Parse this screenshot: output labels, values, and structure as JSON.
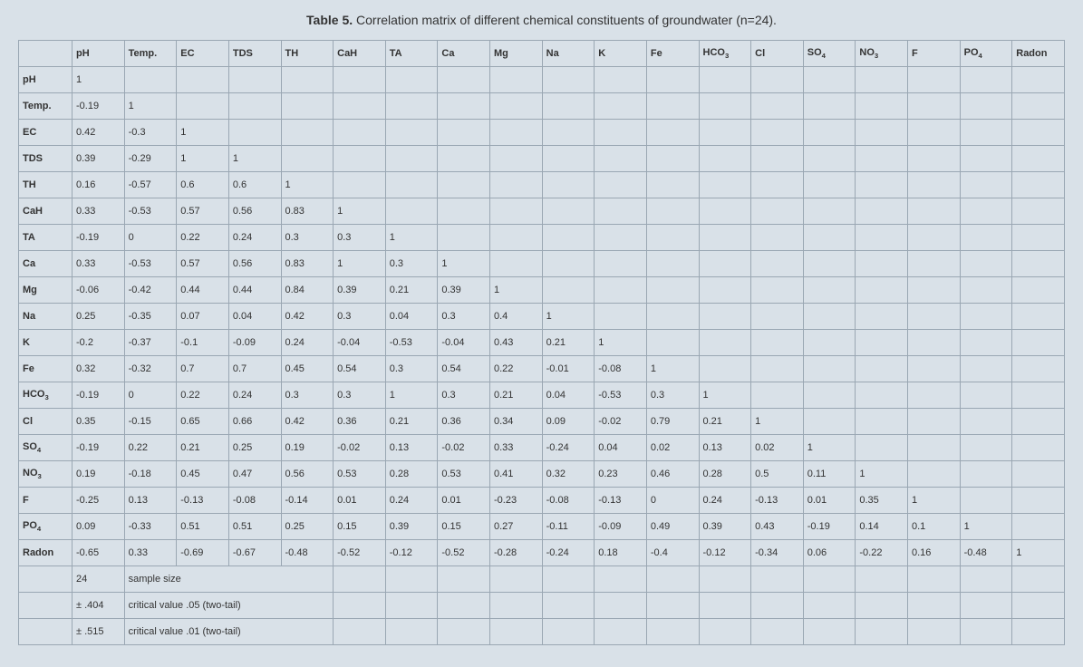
{
  "title_prefix": "Table 5.",
  "title_rest": " Correlation matrix of different chemical constituents of groundwater (n=24).",
  "headers": [
    "pH",
    "Temp.",
    "EC",
    "TDS",
    "TH",
    "CaH",
    "TA",
    "Ca",
    "Mg",
    "Na",
    "K",
    "Fe",
    "HCO3",
    "Cl",
    "SO4",
    "NO3",
    "F",
    "PO4",
    "Radon"
  ],
  "rows": [
    {
      "name": "pH",
      "vals": [
        "1"
      ]
    },
    {
      "name": "Temp.",
      "vals": [
        "-0.19",
        "1"
      ]
    },
    {
      "name": "EC",
      "vals": [
        "0.42",
        "-0.3",
        "1"
      ]
    },
    {
      "name": "TDS",
      "vals": [
        "0.39",
        "-0.29",
        "1",
        "1"
      ]
    },
    {
      "name": "TH",
      "vals": [
        "0.16",
        "-0.57",
        "0.6",
        "0.6",
        "1"
      ]
    },
    {
      "name": "CaH",
      "vals": [
        "0.33",
        "-0.53",
        "0.57",
        "0.56",
        "0.83",
        "1"
      ]
    },
    {
      "name": "TA",
      "vals": [
        "-0.19",
        "0",
        "0.22",
        "0.24",
        "0.3",
        "0.3",
        "1"
      ]
    },
    {
      "name": "Ca",
      "vals": [
        "0.33",
        "-0.53",
        "0.57",
        "0.56",
        "0.83",
        "1",
        "0.3",
        "1"
      ]
    },
    {
      "name": "Mg",
      "vals": [
        "-0.06",
        "-0.42",
        "0.44",
        "0.44",
        "0.84",
        "0.39",
        "0.21",
        "0.39",
        "1"
      ]
    },
    {
      "name": "Na",
      "vals": [
        "0.25",
        "-0.35",
        "0.07",
        "0.04",
        "0.42",
        "0.3",
        "0.04",
        "0.3",
        "0.4",
        "1"
      ]
    },
    {
      "name": "K",
      "vals": [
        "-0.2",
        "-0.37",
        "-0.1",
        "-0.09",
        "0.24",
        "-0.04",
        "-0.53",
        "-0.04",
        "0.43",
        "0.21",
        "1"
      ]
    },
    {
      "name": "Fe",
      "vals": [
        "0.32",
        "-0.32",
        "0.7",
        "0.7",
        "0.45",
        "0.54",
        "0.3",
        "0.54",
        "0.22",
        "-0.01",
        "-0.08",
        "1"
      ]
    },
    {
      "name": "HCO3",
      "vals": [
        "-0.19",
        "0",
        "0.22",
        "0.24",
        "0.3",
        "0.3",
        "1",
        "0.3",
        "0.21",
        "0.04",
        "-0.53",
        "0.3",
        "1"
      ]
    },
    {
      "name": "Cl",
      "vals": [
        "0.35",
        "-0.15",
        "0.65",
        "0.66",
        "0.42",
        "0.36",
        "0.21",
        "0.36",
        "0.34",
        "0.09",
        "-0.02",
        "0.79",
        "0.21",
        "1"
      ]
    },
    {
      "name": "SO4",
      "vals": [
        "-0.19",
        "0.22",
        "0.21",
        "0.25",
        "0.19",
        "-0.02",
        "0.13",
        "-0.02",
        "0.33",
        "-0.24",
        "0.04",
        "0.02",
        "0.13",
        "0.02",
        "1"
      ]
    },
    {
      "name": "NO3",
      "vals": [
        "0.19",
        "-0.18",
        "0.45",
        "0.47",
        "0.56",
        "0.53",
        "0.28",
        "0.53",
        "0.41",
        "0.32",
        "0.23",
        "0.46",
        "0.28",
        "0.5",
        "0.11",
        "1"
      ]
    },
    {
      "name": "F",
      "vals": [
        "-0.25",
        "0.13",
        "-0.13",
        "-0.08",
        "-0.14",
        "0.01",
        "0.24",
        "0.01",
        "-0.23",
        "-0.08",
        "-0.13",
        "0",
        "0.24",
        "-0.13",
        "0.01",
        "0.35",
        "1"
      ]
    },
    {
      "name": "PO4",
      "vals": [
        "0.09",
        "-0.33",
        "0.51",
        "0.51",
        "0.25",
        "0.15",
        "0.39",
        "0.15",
        "0.27",
        "-0.11",
        "-0.09",
        "0.49",
        "0.39",
        "0.43",
        "-0.19",
        "0.14",
        "0.1",
        "1"
      ]
    },
    {
      "name": "Radon",
      "vals": [
        "-0.65",
        "0.33",
        "-0.69",
        "-0.67",
        "-0.48",
        "-0.52",
        "-0.12",
        "-0.52",
        "-0.28",
        "-0.24",
        "0.18",
        "-0.4",
        "-0.12",
        "-0.34",
        "0.06",
        "-0.22",
        "0.16",
        "-0.48",
        "1"
      ]
    }
  ],
  "footer": [
    {
      "col1": "24",
      "span": "sample size"
    },
    {
      "col1": "± .404",
      "span": "critical value .05 (two-tail)"
    },
    {
      "col1": "± .515",
      "span": "critical value .01 (two-tail)"
    }
  ],
  "chart_data": {
    "type": "table",
    "title": "Correlation matrix of different chemical constituents of groundwater (n=24)",
    "variables": [
      "pH",
      "Temp.",
      "EC",
      "TDS",
      "TH",
      "CaH",
      "TA",
      "Ca",
      "Mg",
      "Na",
      "K",
      "Fe",
      "HCO3",
      "Cl",
      "SO4",
      "NO3",
      "F",
      "PO4",
      "Radon"
    ],
    "matrix": [
      [
        1
      ],
      [
        -0.19,
        1
      ],
      [
        0.42,
        -0.3,
        1
      ],
      [
        0.39,
        -0.29,
        1,
        1
      ],
      [
        0.16,
        -0.57,
        0.6,
        0.6,
        1
      ],
      [
        0.33,
        -0.53,
        0.57,
        0.56,
        0.83,
        1
      ],
      [
        -0.19,
        0,
        0.22,
        0.24,
        0.3,
        0.3,
        1
      ],
      [
        0.33,
        -0.53,
        0.57,
        0.56,
        0.83,
        1,
        0.3,
        1
      ],
      [
        -0.06,
        -0.42,
        0.44,
        0.44,
        0.84,
        0.39,
        0.21,
        0.39,
        1
      ],
      [
        0.25,
        -0.35,
        0.07,
        0.04,
        0.42,
        0.3,
        0.04,
        0.3,
        0.4,
        1
      ],
      [
        -0.2,
        -0.37,
        -0.1,
        -0.09,
        0.24,
        -0.04,
        -0.53,
        -0.04,
        0.43,
        0.21,
        1
      ],
      [
        0.32,
        -0.32,
        0.7,
        0.7,
        0.45,
        0.54,
        0.3,
        0.54,
        0.22,
        -0.01,
        -0.08,
        1
      ],
      [
        -0.19,
        0,
        0.22,
        0.24,
        0.3,
        0.3,
        1,
        0.3,
        0.21,
        0.04,
        -0.53,
        0.3,
        1
      ],
      [
        0.35,
        -0.15,
        0.65,
        0.66,
        0.42,
        0.36,
        0.21,
        0.36,
        0.34,
        0.09,
        -0.02,
        0.79,
        0.21,
        1
      ],
      [
        -0.19,
        0.22,
        0.21,
        0.25,
        0.19,
        -0.02,
        0.13,
        -0.02,
        0.33,
        -0.24,
        0.04,
        0.02,
        0.13,
        0.02,
        1
      ],
      [
        0.19,
        -0.18,
        0.45,
        0.47,
        0.56,
        0.53,
        0.28,
        0.53,
        0.41,
        0.32,
        0.23,
        0.46,
        0.28,
        0.5,
        0.11,
        1
      ],
      [
        -0.25,
        0.13,
        -0.13,
        -0.08,
        -0.14,
        0.01,
        0.24,
        0.01,
        -0.23,
        -0.08,
        -0.13,
        0,
        0.24,
        -0.13,
        0.01,
        0.35,
        1
      ],
      [
        0.09,
        -0.33,
        0.51,
        0.51,
        0.25,
        0.15,
        0.39,
        0.15,
        0.27,
        -0.11,
        -0.09,
        0.49,
        0.39,
        0.43,
        -0.19,
        0.14,
        0.1,
        1
      ],
      [
        -0.65,
        0.33,
        -0.69,
        -0.67,
        -0.48,
        -0.52,
        -0.12,
        -0.52,
        -0.28,
        -0.24,
        0.18,
        -0.4,
        -0.12,
        -0.34,
        0.06,
        -0.22,
        0.16,
        -0.48,
        1
      ]
    ],
    "n": 24,
    "critical_values": {
      "p05_two_tail": 0.404,
      "p01_two_tail": 0.515
    }
  }
}
